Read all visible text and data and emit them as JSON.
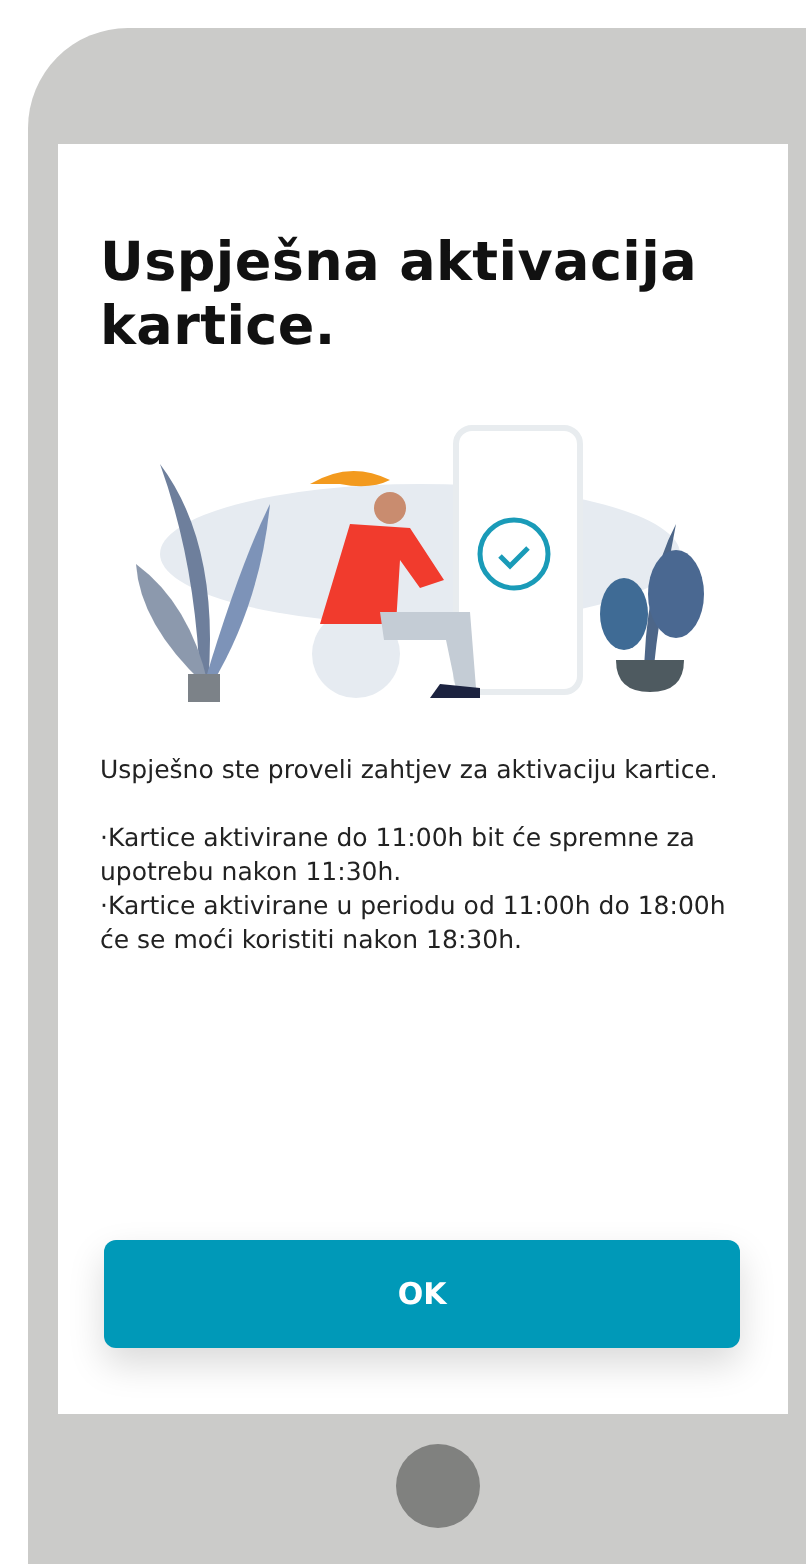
{
  "screen": {
    "title": "Uspješna aktivacija kartice.",
    "intro": "Uspješno ste proveli zahtjev za aktivaciju kartice.",
    "notes": [
      "·Kartice aktivirane do 11:00h bit će spremne za upotrebu nakon 11:30h.",
      "·Kartice aktivirane u periodu od 11:00h do 18:00h će se moći koristiti nakon 18:30h."
    ],
    "button": "OK"
  }
}
